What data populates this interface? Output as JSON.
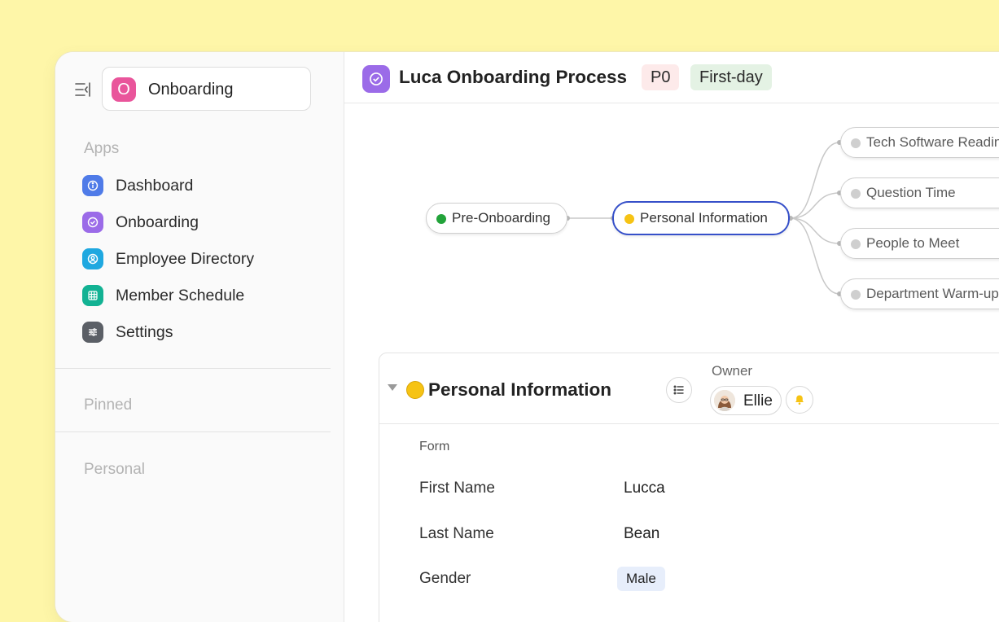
{
  "sidebar": {
    "workspace": {
      "initial": "O",
      "name": "Onboarding",
      "color": "#E9559B"
    },
    "apps_label": "Apps",
    "items": [
      {
        "label": "Dashboard",
        "icon": "info-icon",
        "color": "#4F7BE8"
      },
      {
        "label": "Onboarding",
        "icon": "check-circle-icon",
        "color": "#9B6BE8"
      },
      {
        "label": "Employee Directory",
        "icon": "user-circle-icon",
        "color": "#1FA8E0"
      },
      {
        "label": "Member Schedule",
        "icon": "calendar-grid-icon",
        "color": "#12B293"
      },
      {
        "label": "Settings",
        "icon": "sliders-icon",
        "color": "#5B5F66"
      }
    ],
    "pinned_label": "Pinned",
    "personal_label": "Personal"
  },
  "header": {
    "title": "Luca Onboarding Process",
    "icon": "check-circle-icon",
    "priority_tag": "P0",
    "stage_tag": "First-day"
  },
  "mindmap": {
    "root": {
      "label": "Pre-Onboarding",
      "status_color": "#22A33A"
    },
    "selected": {
      "label": "Personal Information",
      "status_color": "#F6C314"
    },
    "children": [
      {
        "label": "Tech Software Readiness"
      },
      {
        "label": "Question Time"
      },
      {
        "label": "People to Meet"
      },
      {
        "label": "Department Warm-up"
      }
    ]
  },
  "detail": {
    "title": "Personal Information",
    "owner_label": "Owner",
    "owner_name": "Ellie",
    "form_label": "Form",
    "fields": [
      {
        "label": "First Name",
        "value": "Lucca"
      },
      {
        "label": "Last Name",
        "value": "Bean"
      },
      {
        "label": "Gender",
        "value": "Male"
      }
    ]
  }
}
